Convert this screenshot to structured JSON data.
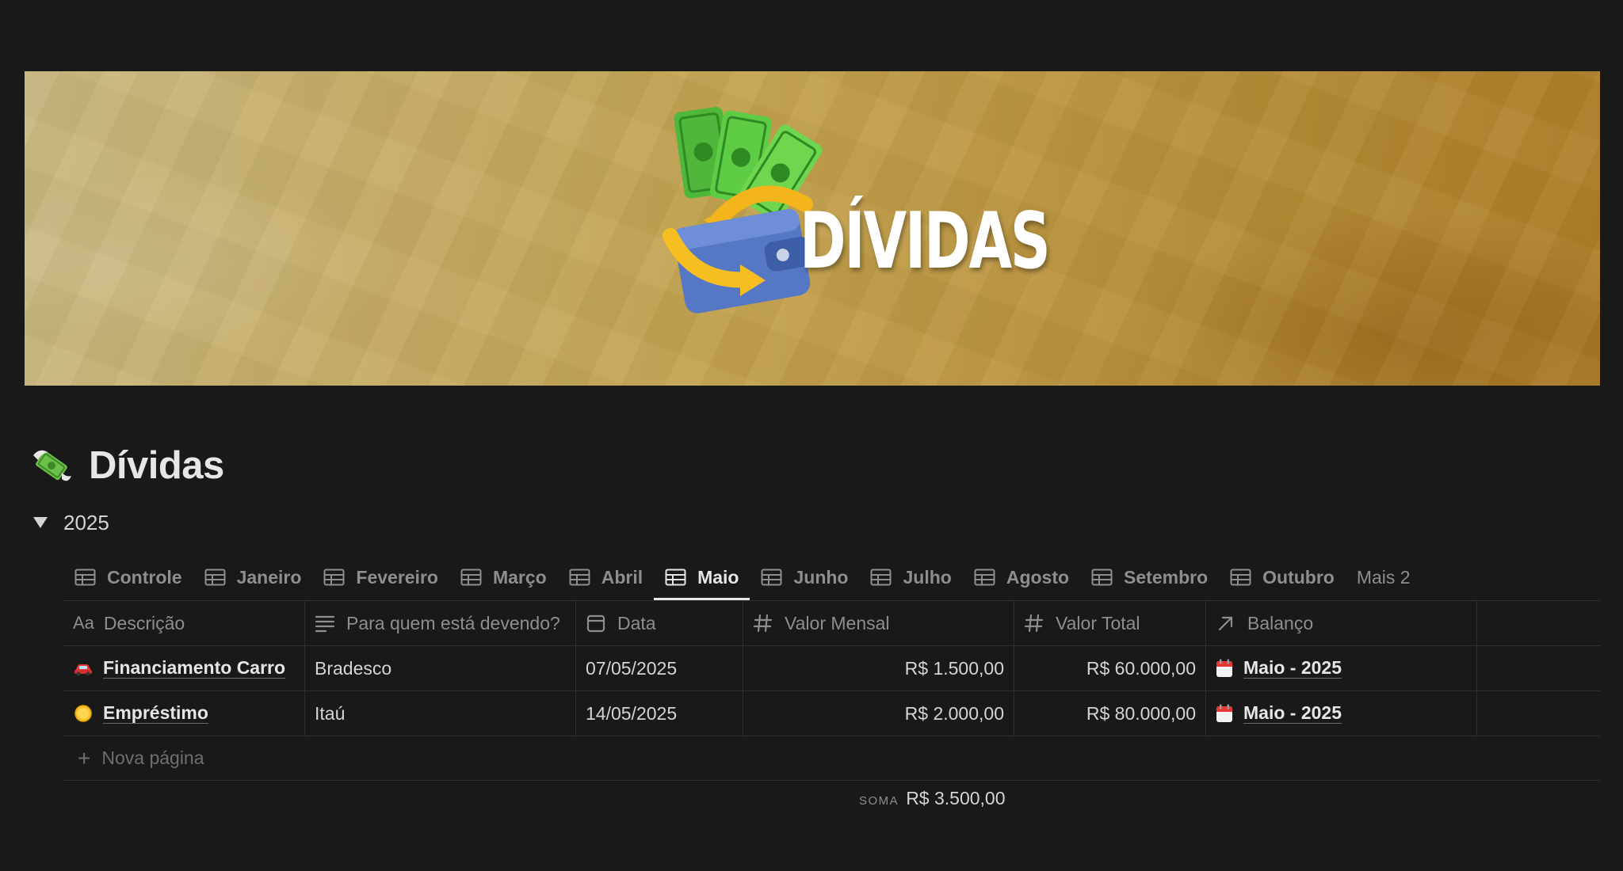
{
  "cover": {
    "word": "DÍVIDAS"
  },
  "page": {
    "title": "Dívidas",
    "icon": "money-with-wings-icon"
  },
  "toggle": {
    "label": "2025"
  },
  "tabs": [
    {
      "label": "Controle",
      "active": false
    },
    {
      "label": "Janeiro",
      "active": false
    },
    {
      "label": "Fevereiro",
      "active": false
    },
    {
      "label": "Março",
      "active": false
    },
    {
      "label": "Abril",
      "active": false
    },
    {
      "label": "Maio",
      "active": true
    },
    {
      "label": "Junho",
      "active": false
    },
    {
      "label": "Julho",
      "active": false
    },
    {
      "label": "Agosto",
      "active": false
    },
    {
      "label": "Setembro",
      "active": false
    },
    {
      "label": "Outubro",
      "active": false
    }
  ],
  "tabs_more": "Mais 2",
  "table": {
    "columns": {
      "descricao_prefix": "Aa",
      "descricao": "Descrição",
      "para_quem": "Para quem está devendo?",
      "data": "Data",
      "valor_mensal": "Valor Mensal",
      "valor_total": "Valor Total",
      "balanco": "Balanço"
    },
    "rows": [
      {
        "emoji": "red-car-icon",
        "descricao": "Financiamento Carro",
        "para_quem": "Bradesco",
        "data": "07/05/2025",
        "valor_mensal": "R$ 1.500,00",
        "valor_total": "R$ 60.000,00",
        "balanco": "Maio - 2025"
      },
      {
        "emoji": "coin-icon",
        "descricao": "Empréstimo",
        "para_quem": "Itaú",
        "data": "14/05/2025",
        "valor_mensal": "R$ 2.000,00",
        "valor_total": "R$ 80.000,00",
        "balanco": "Maio - 2025"
      }
    ],
    "new_row": "Nova página",
    "sum_label": "SOMA",
    "sum_value": "R$ 3.500,00"
  },
  "colors": {
    "background": "#191919",
    "text": "#d4d4d4",
    "muted": "#8e8e8e",
    "border": "#2f2f2f",
    "cover_gold": "#c4a350"
  }
}
